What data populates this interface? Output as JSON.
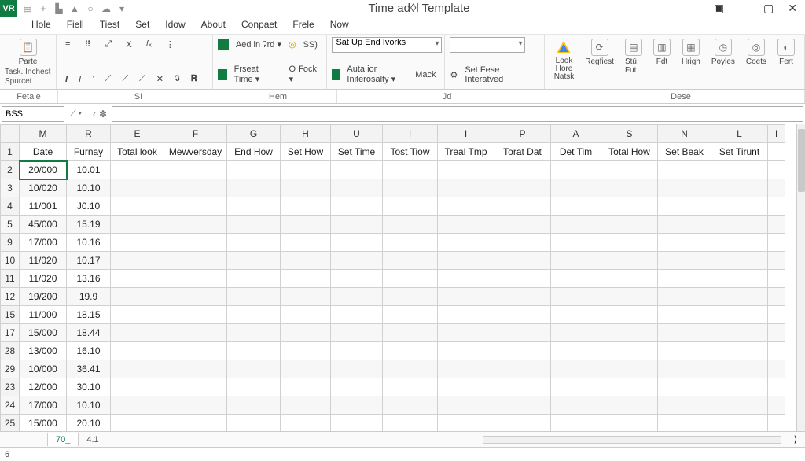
{
  "title": "Time ad◊l Template",
  "badge": "VR",
  "menu": [
    "Hole",
    "Fiell",
    "Tiest",
    "Set",
    "Idow",
    "About",
    "Conpaet",
    "Frele",
    "Now"
  ],
  "paste_label": "Parte",
  "paste_sub": "Task.\nInchest\nSpurcet",
  "font_row": [
    "≡",
    "⠿",
    "⤢",
    "X",
    "𝑓ₓ",
    "⋮"
  ],
  "font_btns": [
    "I",
    "I",
    "ʼ",
    "⟋",
    "⟋",
    "⟋",
    "✕",
    "𝕴",
    "𝐑"
  ],
  "mid_a": "Aed in ʔrd ▾",
  "mid_b": "SS)",
  "mid_c": "Frseat Time ▾",
  "mid_d": "O Fock ▾",
  "dd1": "Sat Up End Ivorks",
  "dd2": "",
  "auto": "Auta ior Initerosalty ▾",
  "mack": "Mack",
  "fese": "Set Fese Interatved",
  "right_btns": [
    "Look Hore Natsk",
    "Regfiest",
    "Stū Fut",
    "Fdt",
    "Hrigh",
    "Poyles",
    "Coets",
    "Fert"
  ],
  "grp_labels": [
    "Fetale",
    "SΙ",
    "Hem",
    "Jd",
    "Dese"
  ],
  "namebox": "BSS",
  "sheet1": "70_",
  "sheet2": "4.1",
  "status_left": "6",
  "col_letters": [
    "",
    "M",
    "R",
    "E",
    "F",
    "G",
    "H",
    "U",
    "I",
    "I",
    "P",
    "A",
    "S",
    "N",
    "L",
    "I"
  ],
  "headers": [
    "Date",
    "Furnay",
    "Total look",
    "Mewversday",
    "End How",
    "Set How",
    "Set Time",
    "Tost Tiow",
    "Treal Tmp",
    "Torat Dat",
    "Det Tim",
    "Total How",
    "Set Beak",
    "Set Tirunt",
    ""
  ],
  "rows": [
    {
      "n": "1"
    },
    {
      "n": "2",
      "d": "20/000",
      "f": "10.01",
      "sel": true
    },
    {
      "n": "3",
      "d": "10/020",
      "f": "10.10"
    },
    {
      "n": "4",
      "d": "11/001",
      "f": "J0.10"
    },
    {
      "n": "5",
      "d": "45/000",
      "f": "15.19"
    },
    {
      "n": "9",
      "d": "17/000",
      "f": "10.16"
    },
    {
      "n": "10",
      "d": "11/020",
      "f": "10.17"
    },
    {
      "n": "11",
      "d": "11/020",
      "f": "13.16"
    },
    {
      "n": "12",
      "d": "19/200",
      "f": "19.9"
    },
    {
      "n": "15",
      "d": "11/000",
      "f": "18.15"
    },
    {
      "n": "17",
      "d": "15/000",
      "f": "18.44"
    },
    {
      "n": "28",
      "d": "13/000",
      "f": "16.10"
    },
    {
      "n": "29",
      "d": "10/000",
      "f": "36.41"
    },
    {
      "n": "23",
      "d": "12/000",
      "f": "30.10"
    },
    {
      "n": "24",
      "d": "17/000",
      "f": "10.10"
    },
    {
      "n": "25",
      "d": "15/000",
      "f": "20.10"
    }
  ]
}
